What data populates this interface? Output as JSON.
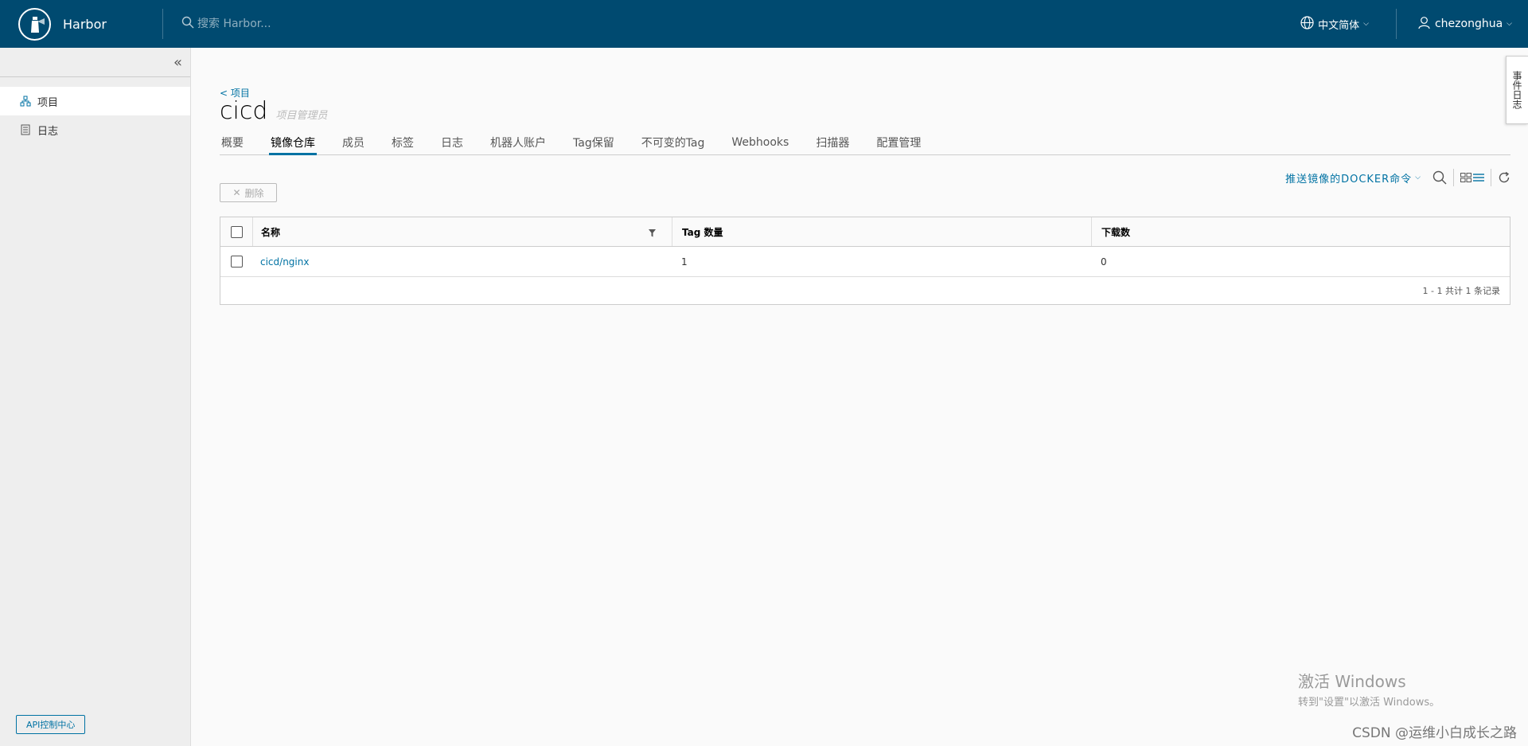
{
  "header": {
    "brand": "Harbor",
    "search_placeholder": "搜索 Harbor...",
    "language": "中文简体",
    "user": "chezonghua"
  },
  "sidebar": {
    "items": [
      {
        "label": "项目",
        "icon": "projects-icon"
      },
      {
        "label": "日志",
        "icon": "logs-icon"
      }
    ],
    "api_button": "API控制中心"
  },
  "main": {
    "back_link": "< 项目",
    "title": "cicd",
    "role": "项目管理员",
    "tabs": [
      "概要",
      "镜像仓库",
      "成员",
      "标签",
      "日志",
      "机器人账户",
      "Tag保留",
      "不可变的Tag",
      "Webhooks",
      "扫描器",
      "配置管理"
    ],
    "active_tab": "镜像仓库",
    "push_command": "推送镜像的DOCKER命令",
    "delete_button": "删除"
  },
  "grid": {
    "columns": [
      "名称",
      "Tag 数量",
      "下载数"
    ],
    "rows": [
      {
        "name": "cicd/nginx",
        "tags": "1",
        "pulls": "0"
      }
    ],
    "footer": "1 - 1 共计 1 条记录"
  },
  "event_tab": "事件日志",
  "watermark": {
    "line1": "激活 Windows",
    "line2": "转到\"设置\"以激活 Windows。",
    "credit": "CSDN @运维小白成长之路"
  },
  "colors": {
    "header_bg": "#004a70",
    "accent": "#0072a3"
  }
}
